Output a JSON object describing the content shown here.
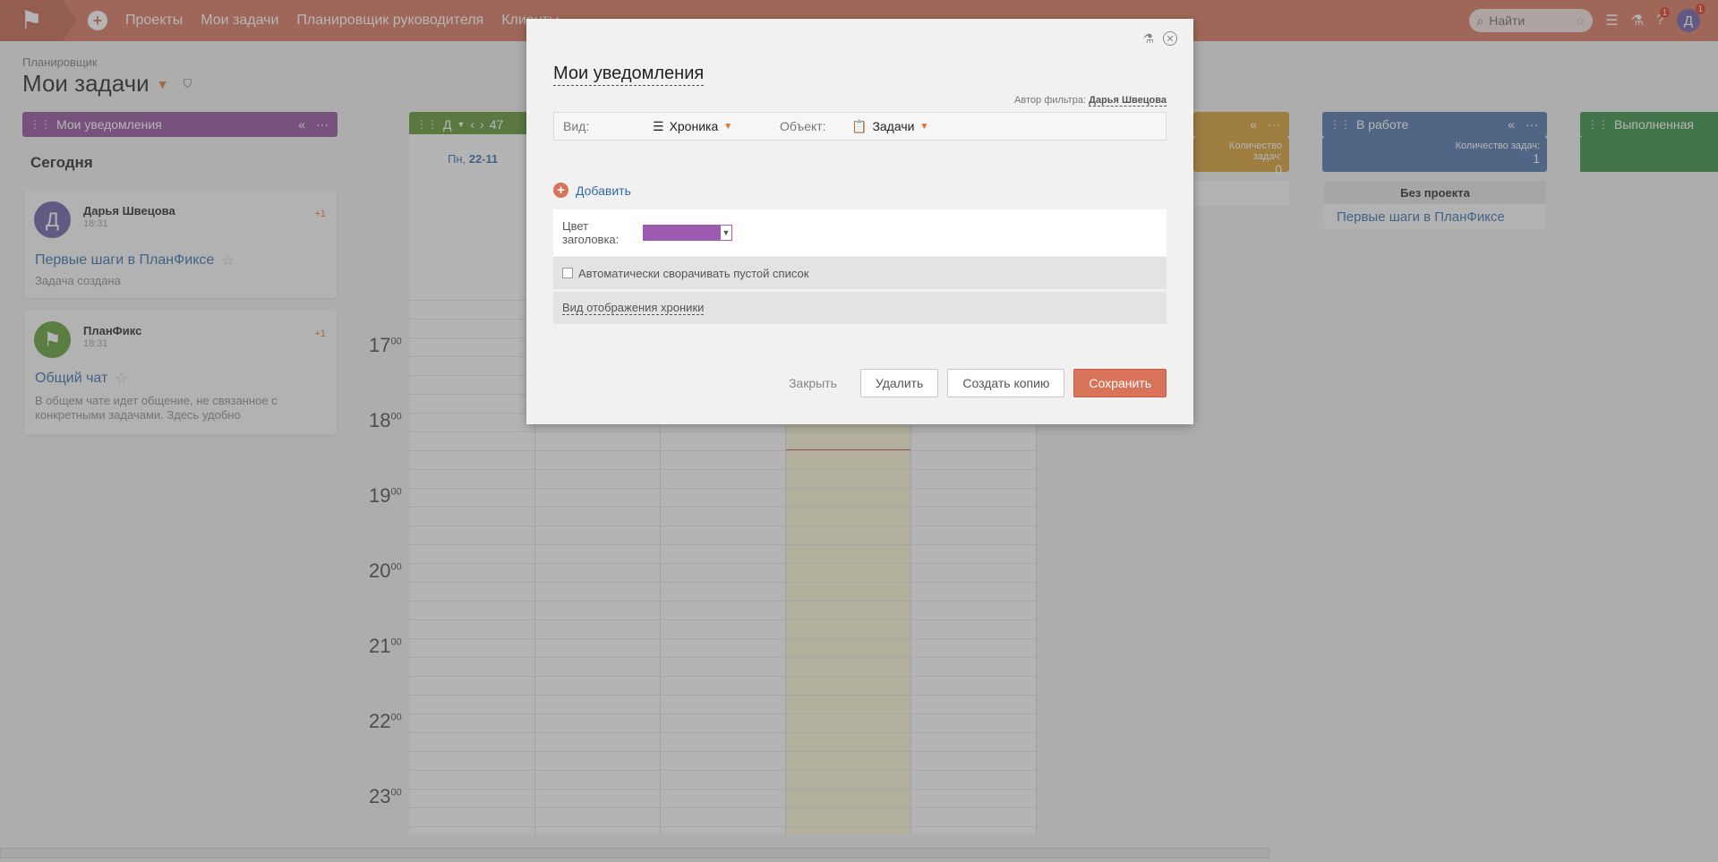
{
  "topbar": {
    "logo": "⚑",
    "nav": [
      "Проекты",
      "Мои задачи",
      "Планировщик руководителя",
      "Клиенты"
    ],
    "search_placeholder": "Найти",
    "help_badge": "1",
    "user_initial": "Д",
    "user_badge": "1"
  },
  "page": {
    "breadcrumb": "Планировщик",
    "title": "Мои задачи"
  },
  "columns": {
    "notifications": {
      "title": "Мои уведомления",
      "color": "#8e4c9a"
    },
    "calendar": {
      "title": "Д",
      "week": "47",
      "day_label": "Пн, ",
      "day_num": "22-11",
      "color": "#58932c"
    },
    "orange": {
      "count_label": "Количество задач:",
      "count": "0",
      "color": "#d49a2a"
    },
    "in_work": {
      "title": "В работе",
      "count_label": "Количество задач:",
      "count": "1",
      "color": "#4a6fa8"
    },
    "done": {
      "title": "Выполненная",
      "color": "#2f8a3c"
    }
  },
  "notifications": {
    "section": "Сегодня",
    "items": [
      {
        "initial": "Д",
        "author": "Дарья Швецова",
        "time": "18:31",
        "plus": "+1",
        "link": "Первые шаги в ПланФиксе",
        "desc": "Задача создана",
        "color": "#6b5aa6"
      },
      {
        "initial": "⚑",
        "author": "ПланФикс",
        "time": "18:31",
        "plus": "+1",
        "link": "Общий чат",
        "desc": "В общем чате идет общение, не связанное с конкретными задачами. Здесь удобно",
        "color": "#5a9a2c"
      }
    ]
  },
  "hours": [
    "17",
    "18",
    "19",
    "20",
    "21",
    "22",
    "23"
  ],
  "hour_suffix": "00",
  "project_card": {
    "header": "Без проекта",
    "link": "Первые шаги в ПланФиксе"
  },
  "modal": {
    "title": "Мои уведомления",
    "author_label": "Автор фильтра:",
    "author_name": "Дарья Швецова",
    "view_label": "Вид:",
    "view_value": "Хроника",
    "object_label": "Объект:",
    "object_value": "Задачи",
    "add_label": "Добавить",
    "color_label": "Цвет заголовка:",
    "color_value": "#9c5ab0",
    "auto_collapse": "Автоматически сворачивать пустой список",
    "chronicle_view": "Вид отображения хроники",
    "btn_close": "Закрыть",
    "btn_delete": "Удалить",
    "btn_copy": "Создать копию",
    "btn_save": "Сохранить"
  }
}
